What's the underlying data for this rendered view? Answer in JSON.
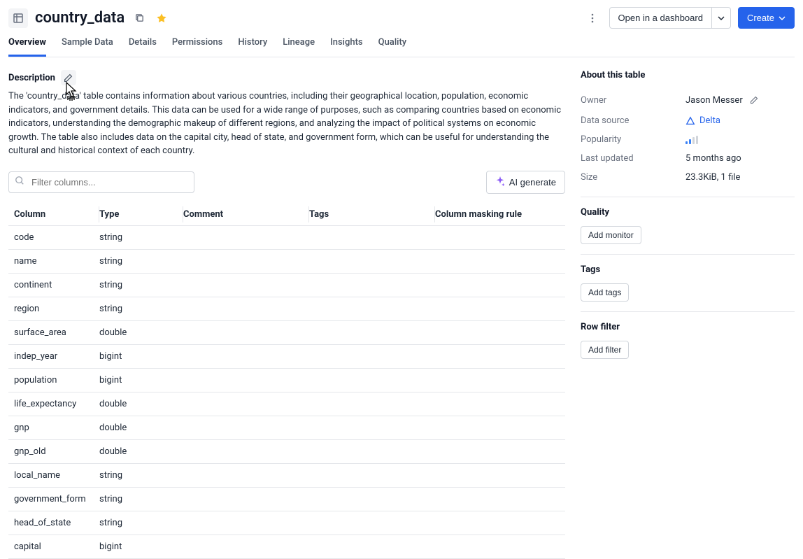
{
  "header": {
    "title": "country_data",
    "open_dashboard_label": "Open in a dashboard",
    "create_label": "Create"
  },
  "tabs": [
    {
      "id": "overview",
      "label": "Overview",
      "active": true
    },
    {
      "id": "sample-data",
      "label": "Sample Data",
      "active": false
    },
    {
      "id": "details",
      "label": "Details",
      "active": false
    },
    {
      "id": "permissions",
      "label": "Permissions",
      "active": false
    },
    {
      "id": "history",
      "label": "History",
      "active": false
    },
    {
      "id": "lineage",
      "label": "Lineage",
      "active": false
    },
    {
      "id": "insights",
      "label": "Insights",
      "active": false
    },
    {
      "id": "quality",
      "label": "Quality",
      "active": false
    }
  ],
  "description": {
    "heading": "Description",
    "text": "The 'country_data' table contains information about various countries, including their geographical location, population, economic indicators, and government details. This data can be used for a wide range of purposes, such as comparing countries based on economic indicators, understanding the demographic makeup of different regions, and analyzing the impact of political systems on economic growth. The table also includes data on the capital city, head of state, and government form, which can be useful for understanding the cultural and historical context of each country."
  },
  "filter": {
    "placeholder": "Filter columns...",
    "ai_generate_label": "AI generate"
  },
  "columns_table": {
    "headers": {
      "column": "Column",
      "type": "Type",
      "comment": "Comment",
      "tags": "Tags",
      "masking": "Column masking rule"
    },
    "rows": [
      {
        "name": "code",
        "type": "string"
      },
      {
        "name": "name",
        "type": "string"
      },
      {
        "name": "continent",
        "type": "string"
      },
      {
        "name": "region",
        "type": "string"
      },
      {
        "name": "surface_area",
        "type": "double"
      },
      {
        "name": "indep_year",
        "type": "bigint"
      },
      {
        "name": "population",
        "type": "bigint"
      },
      {
        "name": "life_expectancy",
        "type": "double"
      },
      {
        "name": "gnp",
        "type": "double"
      },
      {
        "name": "gnp_old",
        "type": "double"
      },
      {
        "name": "local_name",
        "type": "string"
      },
      {
        "name": "government_form",
        "type": "string"
      },
      {
        "name": "head_of_state",
        "type": "string"
      },
      {
        "name": "capital",
        "type": "bigint"
      }
    ]
  },
  "about": {
    "heading": "About this table",
    "owner_label": "Owner",
    "owner_value": "Jason Messer",
    "datasource_label": "Data source",
    "datasource_value": "Delta",
    "popularity_label": "Popularity",
    "last_updated_label": "Last updated",
    "last_updated_value": "5 months ago",
    "size_label": "Size",
    "size_value": "23.3KiB, 1 file"
  },
  "quality": {
    "heading": "Quality",
    "add_monitor_label": "Add monitor"
  },
  "tags": {
    "heading": "Tags",
    "add_tags_label": "Add tags"
  },
  "row_filter": {
    "heading": "Row filter",
    "add_filter_label": "Add filter"
  }
}
